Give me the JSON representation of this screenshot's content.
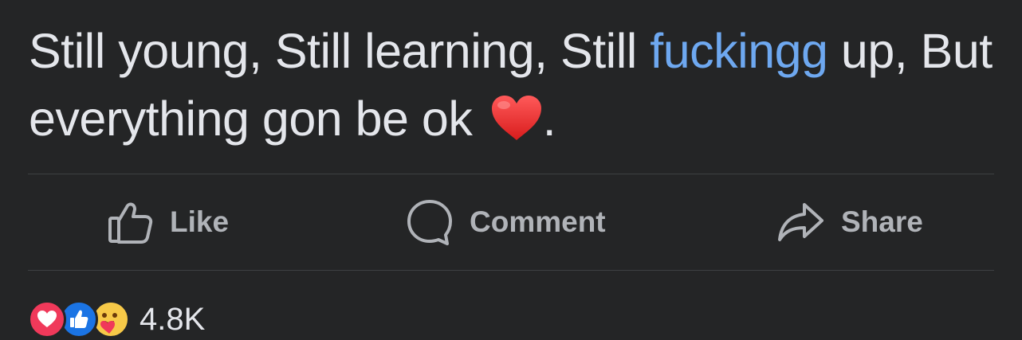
{
  "post": {
    "text_part1": "Still young, Still learning, Still ",
    "text_link": "fuckingg",
    "text_part2": " up, But everything gon be ok ",
    "text_end": ".",
    "emoji": "red-heart"
  },
  "actions": {
    "like_label": "Like",
    "comment_label": "Comment",
    "share_label": "Share"
  },
  "reactions": {
    "icons": [
      "love",
      "like",
      "care"
    ],
    "count": "4.8K"
  },
  "colors": {
    "background": "#242526",
    "text": "#e4e6eb",
    "link": "#6ea8f0",
    "muted": "#b0b3b8",
    "divider": "#3e4042",
    "love": "#f0395a",
    "like": "#1b74e4",
    "care": "#f7c948"
  }
}
